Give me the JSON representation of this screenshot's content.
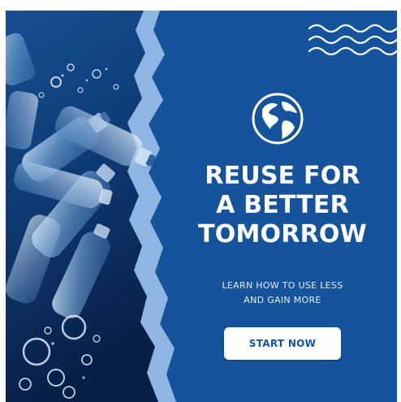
{
  "poster": {
    "headline_lines": [
      "REUSE FOR",
      "A BETTER",
      "TOMORROW"
    ],
    "subline_lines": [
      "LEARN HOW TO USE LESS",
      "AND GAIN MORE"
    ],
    "button_label": "START NOW"
  },
  "colors": {
    "panel_blue": "#15549c",
    "torn_edge": "#8fb6e2",
    "photo_dark": "#0b2b5c",
    "text": "#ffffff"
  },
  "icons": {
    "decoration": "wave-lines-icon",
    "emblem": "globe-icon",
    "photo": "water-bottles-photo"
  }
}
